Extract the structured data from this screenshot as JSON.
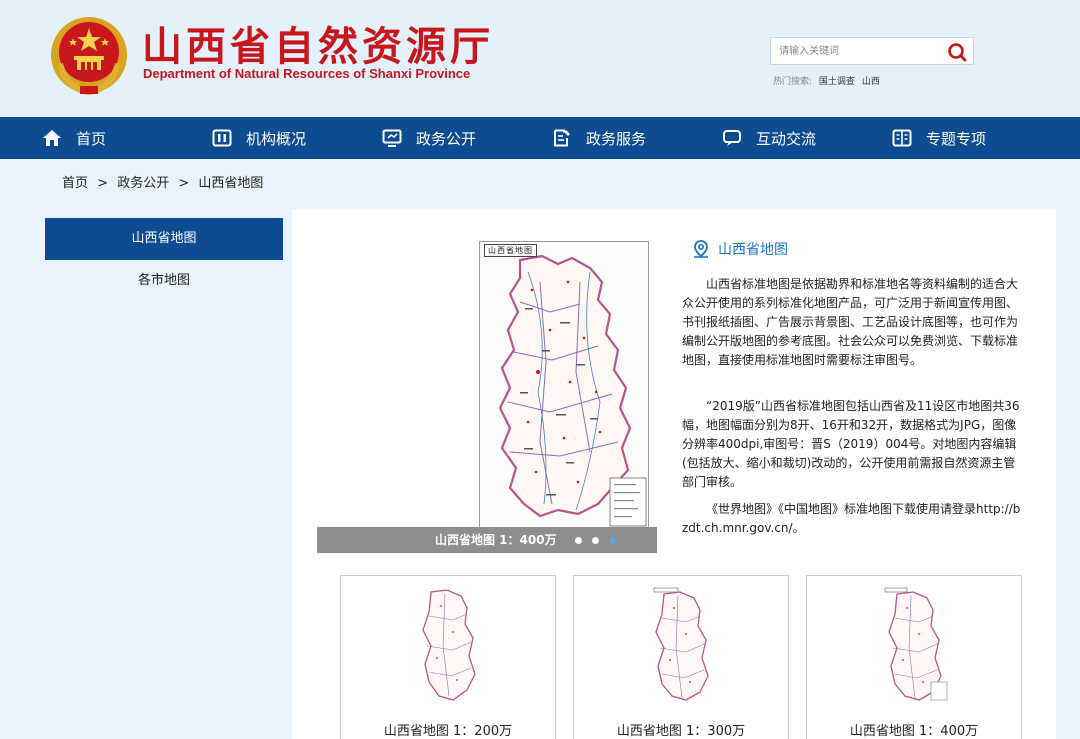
{
  "header": {
    "title_cn": "山西省自然资源厅",
    "title_en": "Department of Natural Resources of Shanxi Province",
    "search_placeholder": "请输入关键词",
    "hot_label": "热门搜索:",
    "hot_links": [
      "国土调查",
      "山西"
    ]
  },
  "nav": {
    "items": [
      {
        "label": "首页",
        "icon": "home-icon"
      },
      {
        "label": "机构概况",
        "icon": "organization-icon"
      },
      {
        "label": "政务公开",
        "icon": "monitor-icon"
      },
      {
        "label": "政务服务",
        "icon": "document-edit-icon"
      },
      {
        "label": "互动交流",
        "icon": "chat-icon"
      },
      {
        "label": "专题专项",
        "icon": "book-icon"
      }
    ]
  },
  "breadcrumb": {
    "items": [
      "首页",
      "政务公开",
      "山西省地图"
    ],
    "separator": ">"
  },
  "sidebar": {
    "items": [
      {
        "label": "山西省地图",
        "active": true
      },
      {
        "label": "各市地图",
        "active": false
      }
    ]
  },
  "main": {
    "map_label": "山西省地图",
    "slide_caption": "山西省地图 1：400万",
    "slide_count": 3,
    "active_slide": 3,
    "info_title": "山西省地图",
    "paragraphs": [
      "山西省标准地图是依据勘界和标准地名等资料编制的适合大众公开使用的系列标准化地图产品，可广泛用于新闻宣传用图、书刊报纸插图、广告展示背景图、工艺品设计底图等，也可作为编制公开版地图的参考底图。社会公众可以免费浏览、下载标准地图，直接使用标准地图时需要标注审图号。",
      "“2019版”山西省标准地图包括山西省及11设区市地图共36幅，地图幅面分别为8开、16开和32开，数据格式为JPG，图像分辨率400dpi,审图号：晋S（2019）004号。对地图内容编辑(包括放大、缩小和裁切)改动的，公开使用前需报自然资源主管部门审核。",
      "《世界地图》《中国地图》标准地图下载使用请登录http://bzdt.ch.mnr.gov.cn/。"
    ],
    "thumbnails": [
      {
        "label": "山西省地图 1：200万"
      },
      {
        "label": "山西省地图 1：300万"
      },
      {
        "label": "山西省地图 1：400万"
      }
    ]
  },
  "colors": {
    "brand_red": "#c8161d",
    "nav_blue": "#0e4c92",
    "accent_blue": "#1a73c8",
    "page_bg": "#eaf2fb"
  }
}
